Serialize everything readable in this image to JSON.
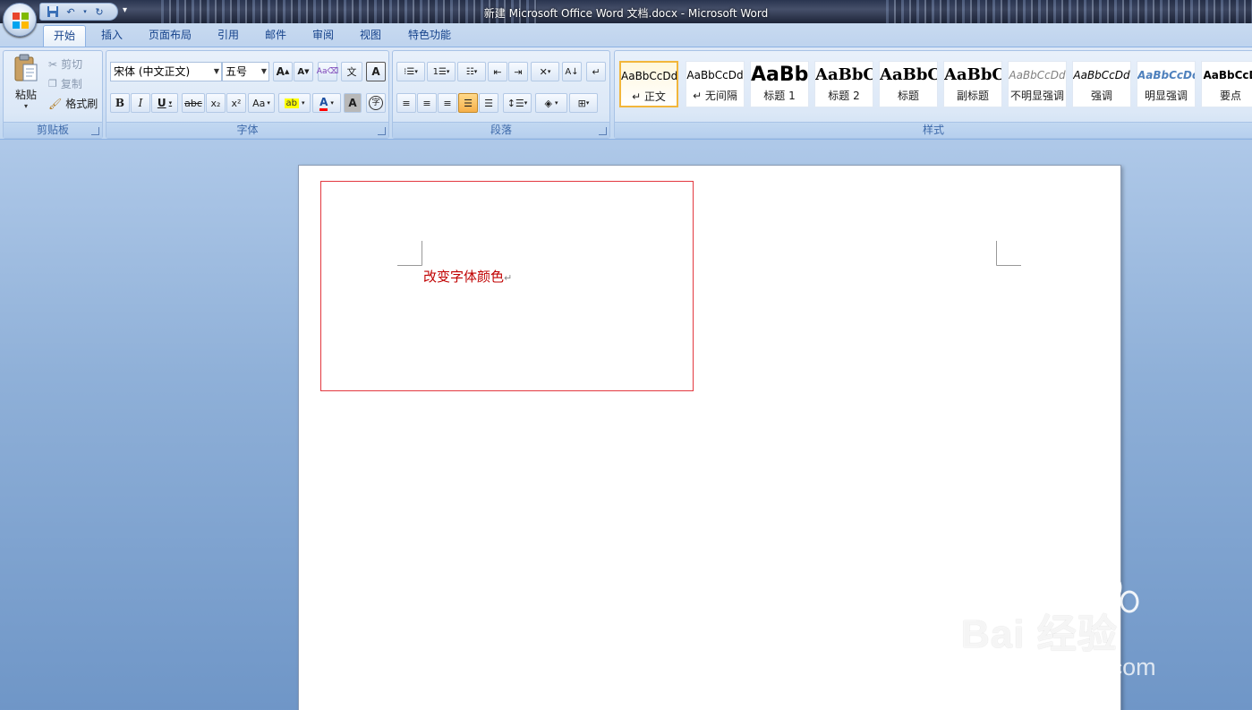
{
  "window": {
    "title": "新建 Microsoft Office Word 文档.docx - Microsoft Word"
  },
  "tabs": [
    {
      "label": "开始",
      "active": true
    },
    {
      "label": "插入"
    },
    {
      "label": "页面布局"
    },
    {
      "label": "引用"
    },
    {
      "label": "邮件"
    },
    {
      "label": "审阅"
    },
    {
      "label": "视图"
    },
    {
      "label": "特色功能"
    }
  ],
  "clipboard": {
    "group_label": "剪贴板",
    "paste_label": "粘贴",
    "cut_label": "剪切",
    "copy_label": "复制",
    "format_painter_label": "格式刷"
  },
  "font": {
    "group_label": "字体",
    "font_name": "宋体 (中文正文)",
    "font_size": "五号",
    "grow_label": "A",
    "shrink_label": "A",
    "bold": "B",
    "italic": "I",
    "underline": "U",
    "strike": "abc",
    "subscript": "x₂",
    "superscript": "x²",
    "case": "Aa",
    "color_a": "A",
    "shading_a": "A",
    "pinyin": "文",
    "border_a": "A",
    "enclose": "字"
  },
  "paragraph": {
    "group_label": "段落"
  },
  "styles": {
    "group_label": "样式",
    "items": [
      {
        "sample": "AaBbCcDd",
        "name": "↵ 正文",
        "selected": true
      },
      {
        "sample": "AaBbCcDd",
        "name": "↵ 无间隔"
      },
      {
        "sample": "AaBb",
        "name": "标题 1"
      },
      {
        "sample": "AaBbC",
        "name": "标题 2"
      },
      {
        "sample": "AaBbC",
        "name": "标题"
      },
      {
        "sample": "AaBbC",
        "name": "副标题"
      },
      {
        "sample": "AaBbCcDd",
        "name": "不明显强调"
      },
      {
        "sample": "AaBbCcDd",
        "name": "强调"
      },
      {
        "sample": "AaBbCcDd",
        "name": "明显强调"
      },
      {
        "sample": "AaBbCcD",
        "name": "要点"
      }
    ]
  },
  "document": {
    "text": "改变字体颜色",
    "paragraph_mark": "↵",
    "text_color": "#c00000",
    "frame_color": "#e3383f"
  },
  "watermark": {
    "main": "Bai 经验",
    "url": "jingyan.baidu.com"
  },
  "colors": {
    "ribbon": "#dfe9f7",
    "accent": "#15428b",
    "selected_style": "#f2b63b"
  }
}
